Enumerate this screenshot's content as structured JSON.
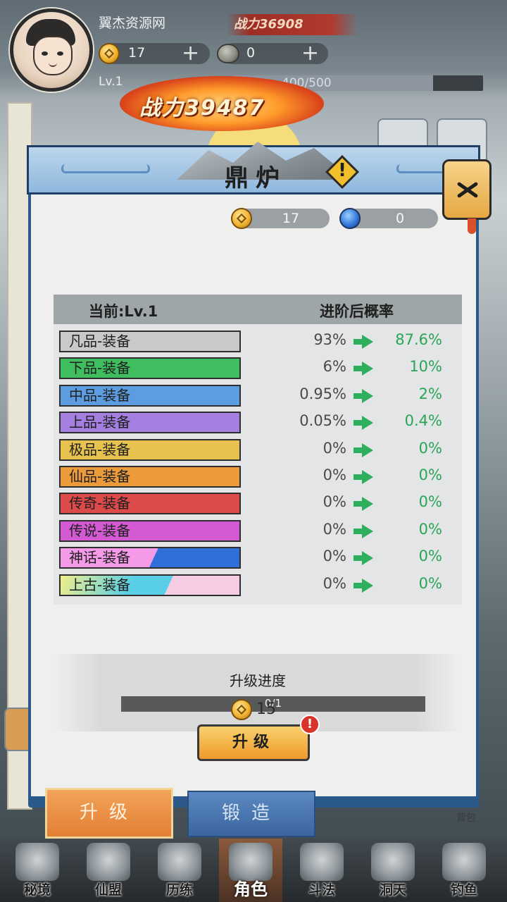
{
  "player": {
    "name": "翼杰资源网",
    "power_small": "战力36908",
    "coins": "17",
    "stones": "0",
    "level": "Lv.1",
    "exp_text": "400/500",
    "exp_fraction": 0.8,
    "power_big": "战力39487"
  },
  "dialog": {
    "title": "鼎炉",
    "res_coins": "17",
    "res_gems": "0",
    "table": {
      "current_label": "当前:Lv.1",
      "next_label": "进阶后概率",
      "rows": [
        {
          "name": "凡品-装备",
          "current": "93%",
          "next": "87.6%"
        },
        {
          "name": "下品-装备",
          "current": "6%",
          "next": "10%"
        },
        {
          "name": "中品-装备",
          "current": "0.95%",
          "next": "2%"
        },
        {
          "name": "上品-装备",
          "current": "0.05%",
          "next": "0.4%"
        },
        {
          "name": "极品-装备",
          "current": "0%",
          "next": "0%"
        },
        {
          "name": "仙品-装备",
          "current": "0%",
          "next": "0%"
        },
        {
          "name": "传奇-装备",
          "current": "0%",
          "next": "0%"
        },
        {
          "name": "传说-装备",
          "current": "0%",
          "next": "0%"
        },
        {
          "name": "神话-装备",
          "current": "0%",
          "next": "0%"
        },
        {
          "name": "上古-装备",
          "current": "0%",
          "next": "0%"
        }
      ]
    },
    "progress": {
      "title": "升级进度",
      "text": "0/1",
      "fraction": 0
    },
    "cost": "15",
    "upgrade_label": "升级",
    "alert_mark": "!"
  },
  "tabs": {
    "upgrade": "升级",
    "forge": "锻造"
  },
  "bag_label": "背包",
  "nav": [
    "秘境",
    "仙盟",
    "历练",
    "角色",
    "斗法",
    "洞天",
    "钓鱼"
  ],
  "colors": {
    "rarity": [
      "#c9c9c9",
      "#3fbe5f",
      "#5b9de0",
      "#a47fe0",
      "#e8c24f",
      "#ec9b3c",
      "#dd4a4a",
      "#d35ad2"
    ],
    "accent_green": "#2aa556"
  },
  "icons": [
    "coin-icon",
    "stone-icon",
    "gem-icon",
    "warning-icon",
    "close-icon",
    "arrow-right-icon"
  ]
}
